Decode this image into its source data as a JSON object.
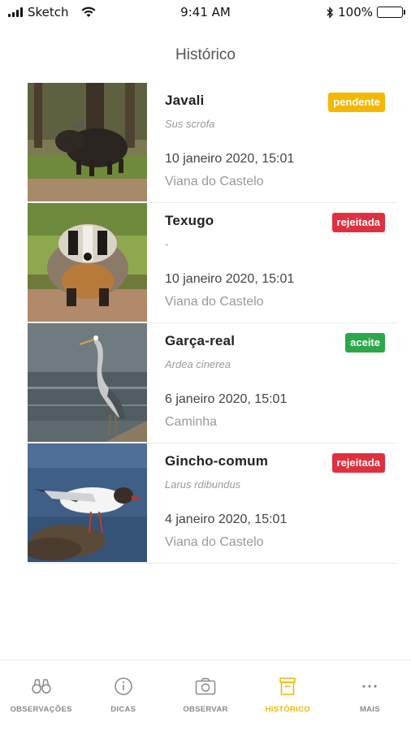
{
  "status_bar": {
    "carrier": "Sketch",
    "time": "9:41 AM",
    "battery": "100%"
  },
  "header": {
    "title": "Histórico"
  },
  "colors": {
    "pendente": "#f5b800",
    "rejeitada": "#e0303f",
    "aceite": "#2aa84a",
    "active_tab": "#f2b705"
  },
  "observations": [
    {
      "name": "Javali",
      "scientific": "Sus scrofa",
      "status": "pendente",
      "date": "10 janeiro 2020, 15:01",
      "place": "Viana do Castelo",
      "image": "wild-boar-photo"
    },
    {
      "name": "Texugo",
      "scientific": "-",
      "status": "rejeitada",
      "date": "10 janeiro 2020, 15:01",
      "place": "Viana do Castelo",
      "image": "badger-photo"
    },
    {
      "name": "Garça-real",
      "scientific": "Ardea cinerea",
      "status": "aceite",
      "date": "6 janeiro 2020, 15:01",
      "place": "Caminha",
      "image": "grey-heron-photo"
    },
    {
      "name": "Gincho-comum",
      "scientific": "Larus rdibundus",
      "status": "rejeitada",
      "date": "4 janeiro 2020, 15:01",
      "place": "Viana do Castelo",
      "image": "gull-photo"
    }
  ],
  "tabs": [
    {
      "label": "OBSERVAÇÕES",
      "icon": "binoculars-icon"
    },
    {
      "label": "DICAS",
      "icon": "info-icon"
    },
    {
      "label": "OBSERVAR",
      "icon": "camera-icon"
    },
    {
      "label": "HISTÓRICO",
      "icon": "archive-icon",
      "active": true
    },
    {
      "label": "MAIS",
      "icon": "more-icon"
    }
  ]
}
